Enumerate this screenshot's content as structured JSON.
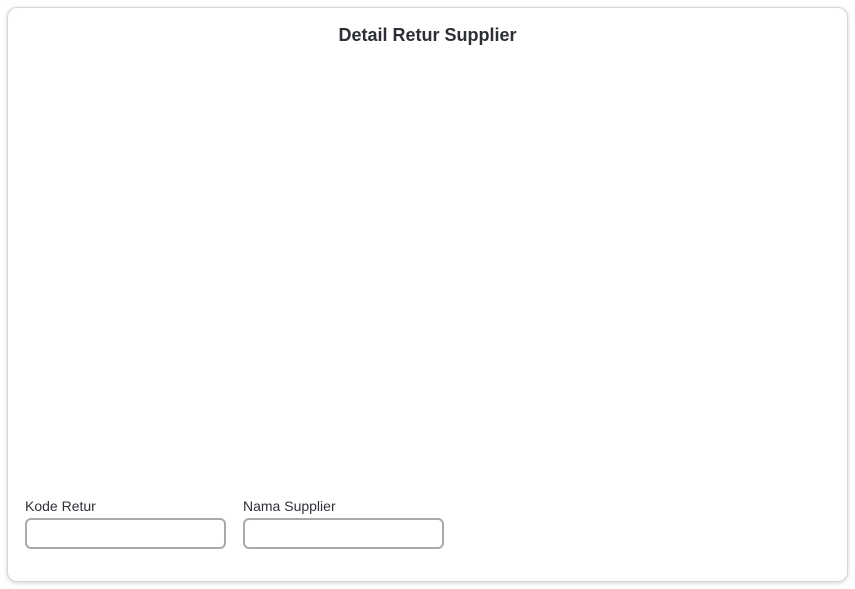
{
  "dialog": {
    "title": "Detail Retur Supplier"
  },
  "form": {
    "kode_retur": {
      "label": "Kode Retur",
      "value": ""
    },
    "nama_supplier": {
      "label": "Nama Supplier",
      "value": ""
    }
  }
}
